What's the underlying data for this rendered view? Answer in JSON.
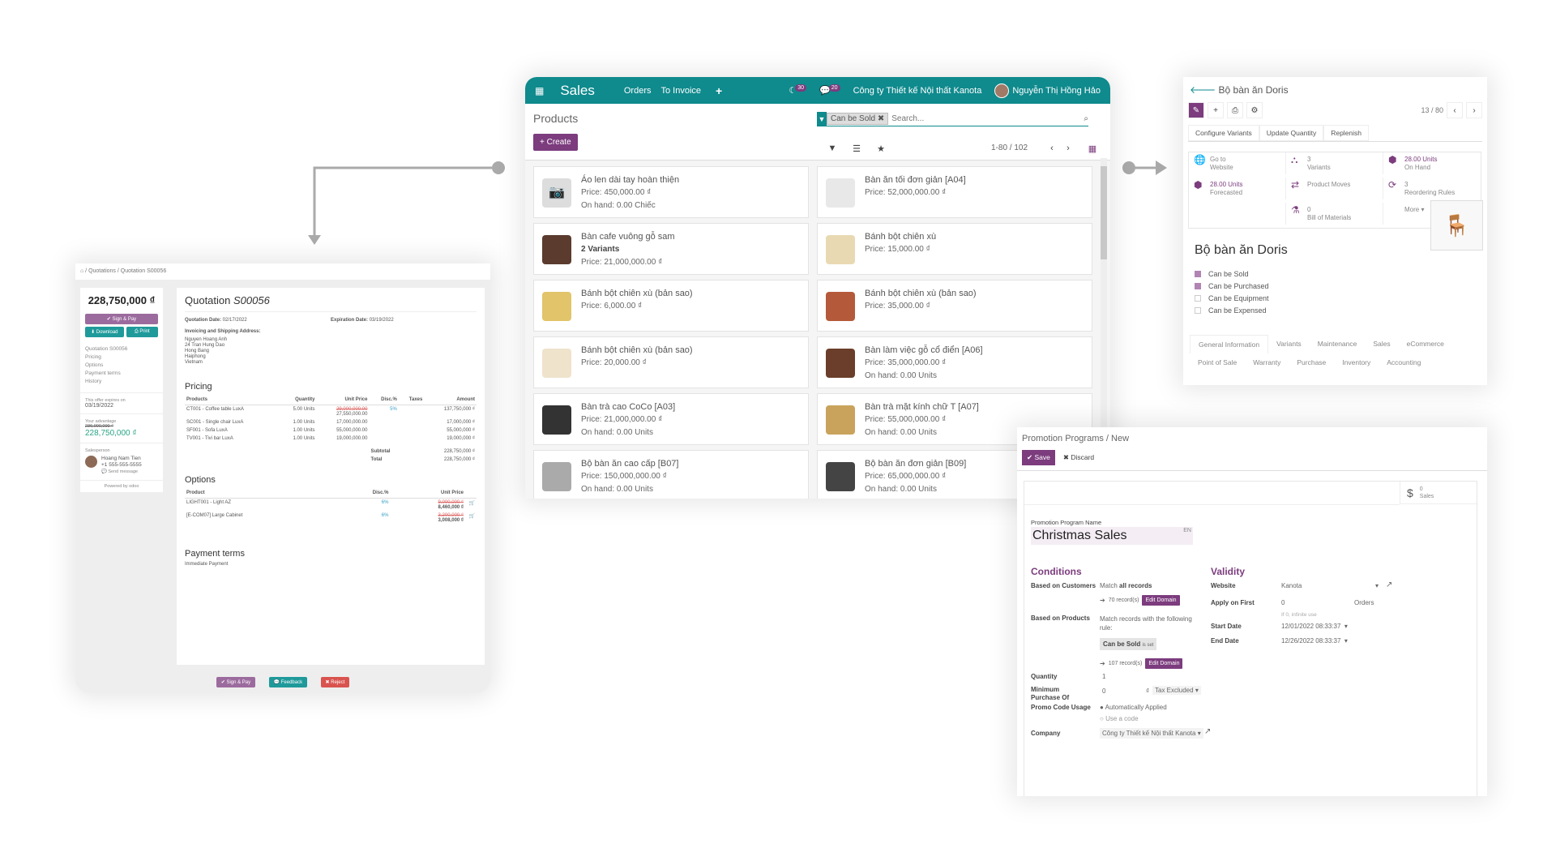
{
  "colors": {
    "teal": "#0f8a8d",
    "purple": "#7c3c7e",
    "red": "#d9534f",
    "green_text": "#28a485"
  },
  "sales_app": {
    "app_name": "Sales",
    "nav": [
      "Orders",
      "To Invoice"
    ],
    "plus_icon": "+",
    "activity_count": "30",
    "message_count": "20",
    "company": "Công ty Thiết kế Nội thất Kanota",
    "user": "Nguyễn Thị Hồng Hảo",
    "page_title": "Products",
    "create_label": "+ Create",
    "facet_label": "Can be Sold",
    "search_placeholder": "Search...",
    "pager": "1-80 / 102",
    "products": [
      {
        "name": "Áo len dài tay hoàn thiện",
        "variants": "",
        "price": "Price: 450,000.00 ₫",
        "onhand": "On hand: 0.00 Chiếc"
      },
      {
        "name": "Bàn ăn tối đơn giản [A04]",
        "variants": "",
        "price": "Price: 52,000,000.00 ₫",
        "onhand": ""
      },
      {
        "name": "Bàn cafe vuông gỗ sam",
        "variants": "2 Variants",
        "price": "Price: 21,000,000.00 ₫",
        "onhand": ""
      },
      {
        "name": "Bánh bột chiên xù",
        "variants": "",
        "price": "Price: 15,000.00 ₫",
        "onhand": ""
      },
      {
        "name": "Bánh bột chiên xù (bản sao)",
        "variants": "",
        "price": "Price: 6,000.00 ₫",
        "onhand": ""
      },
      {
        "name": "Bánh bột chiên xù (bản sao)",
        "variants": "",
        "price": "Price: 35,000.00 ₫",
        "onhand": ""
      },
      {
        "name": "Bánh bột chiên xù (bản sao)",
        "variants": "",
        "price": "Price: 20,000.00 ₫",
        "onhand": ""
      },
      {
        "name": "Bàn làm việc gỗ cổ điển [A06]",
        "variants": "",
        "price": "Price: 35,000,000.00 ₫",
        "onhand": "On hand: 0.00 Units"
      },
      {
        "name": "Bàn trà cao CoCo [A03]",
        "variants": "",
        "price": "Price: 21,000,000.00 ₫",
        "onhand": "On hand: 0.00 Units"
      },
      {
        "name": "Bàn trà mặt kính chữ T [A07]",
        "variants": "",
        "price": "Price: 55,000,000.00 ₫",
        "onhand": "On hand: 0.00 Units"
      },
      {
        "name": "Bộ bàn ăn cao cấp [B07]",
        "variants": "",
        "price": "Price: 150,000,000.00 ₫",
        "onhand": "On hand: 0.00 Units"
      },
      {
        "name": "Bộ bàn ăn đơn giản [B09]",
        "variants": "",
        "price": "Price: 65,000,000.00 ₫",
        "onhand": "On hand: 0.00 Units"
      }
    ]
  },
  "quotation": {
    "breadcrumb": [
      "Quotations",
      "Quotation S00056"
    ],
    "total": "228,750,000 ₫",
    "sign_pay": "✔ Sign & Pay",
    "download": "⬇ Download",
    "print": "⎙ Print",
    "nav": [
      "Quotation S00056",
      "Pricing",
      "Options",
      "Payment terms",
      "History"
    ],
    "expires_label": "This offer expires on",
    "expires_date": "03/19/2022",
    "advantage_label": "Your advantage",
    "advantage_old": "236,000,000 ₫",
    "advantage_new": "228,750,000 ₫",
    "salesperson_label": "Salesperson",
    "salesperson_name": "Hoang Nam Tien",
    "salesperson_phone": "+1 555-555-5555",
    "send_message": "Send message",
    "powered_by": "Powered by odoo",
    "title_prefix": "Quotation",
    "title_number": "S00056",
    "quotation_date_label": "Quotation Date:",
    "quotation_date": "02/17/2022",
    "expiration_date_label": "Expiration Date:",
    "expiration_date": "03/19/2022",
    "address_label": "Invoicing and Shipping Address:",
    "address": [
      "Nguyen Hoang Anh",
      "24 Tran Hung Dao",
      "Hong Bang",
      "Haiphong",
      "Vietnam"
    ],
    "pricing_title": "Pricing",
    "pricing_headers": [
      "Products",
      "Quantity",
      "Unit Price",
      "Disc.%",
      "Taxes",
      "Amount"
    ],
    "pricing_rows": [
      {
        "product": "CT001 - Coffee table LuxA",
        "qty": "5.00 Units",
        "old_price": "29,000,000.00",
        "price": "27,550,000.00",
        "disc": "5%",
        "amount": "137,750,000 ₫"
      },
      {
        "product": "SC001 - Single chair LuxA",
        "qty": "1.00 Units",
        "old_price": "",
        "price": "17,000,000.00",
        "disc": "",
        "amount": "17,000,000 ₫"
      },
      {
        "product": "SF001 - Sofa LuxA",
        "qty": "1.00 Units",
        "old_price": "",
        "price": "55,000,000.00",
        "disc": "",
        "amount": "55,000,000 ₫"
      },
      {
        "product": "TV001 - Tivi bar LuxA",
        "qty": "1.00 Units",
        "old_price": "",
        "price": "19,000,000.00",
        "disc": "",
        "amount": "19,000,000 ₫"
      }
    ],
    "subtotal_label": "Subtotal",
    "subtotal": "228,750,000 ₫",
    "total_label": "Total",
    "total_value": "228,750,000 ₫",
    "options_title": "Options",
    "options_headers": [
      "Product",
      "Disc.%",
      "Unit Price"
    ],
    "options_rows": [
      {
        "product": "LIGHT001 - Light AZ",
        "disc": "6%",
        "old_price": "9,000,000 ₫",
        "price": "8,460,000 ₫"
      },
      {
        "product": "[E-COM07] Large Cabinet",
        "disc": "6%",
        "old_price": "3,200,000 ₫",
        "price": "3,008,000 ₫"
      }
    ],
    "payment_title": "Payment terms",
    "payment_value": "Immediate Payment",
    "footer_sign": "✔ Sign & Pay",
    "footer_feedback": "Feedback",
    "footer_reject": "✖ Reject"
  },
  "product_form": {
    "breadcrumb": "Bộ bàn ăn Doris",
    "pager": "13 / 80",
    "actions": [
      "Configure Variants",
      "Update Quantity",
      "Replenish"
    ],
    "stats": [
      {
        "icon": "globe-icon",
        "value": "Go to",
        "label": "Website",
        "highlight": false
      },
      {
        "icon": "sitemap-icon",
        "value": "3",
        "label": "Variants",
        "highlight": false
      },
      {
        "icon": "cubes-icon",
        "value": "28.00 Units",
        "label": "On Hand",
        "highlight": true
      },
      {
        "icon": "cubes-icon",
        "value": "28.00 Units",
        "label": "Forecasted",
        "highlight": true
      },
      {
        "icon": "exchange-icon",
        "value": "",
        "label": "Product Moves",
        "highlight": false
      },
      {
        "icon": "refresh-icon",
        "value": "3",
        "label": "Reordering Rules",
        "highlight": false
      },
      {
        "icon": "",
        "value": "",
        "label": "",
        "highlight": false
      },
      {
        "icon": "flask-icon",
        "value": "0",
        "label": "Bill of Materials",
        "highlight": false
      },
      {
        "icon": "",
        "value": "",
        "label": "More ▾",
        "highlight": false
      }
    ],
    "name": "Bộ bàn ăn Doris",
    "checks": [
      {
        "label": "Can be Sold",
        "checked": true
      },
      {
        "label": "Can be Purchased",
        "checked": true
      },
      {
        "label": "Can be Equipment",
        "checked": false
      },
      {
        "label": "Can be Expensed",
        "checked": false
      }
    ],
    "tabs": [
      "General Information",
      "Variants",
      "Maintenance",
      "Sales",
      "eCommerce",
      "Point of Sale",
      "Warranty",
      "Purchase",
      "Inventory",
      "Accounting"
    ]
  },
  "promotion": {
    "breadcrumb": [
      "Promotion Programs",
      "New"
    ],
    "save": "✔ Save",
    "discard": "✖ Discard",
    "sales_count": "0",
    "sales_label": "Sales",
    "name_label": "Promotion Program Name",
    "name_value": "Christmas Sales",
    "lang": "EN",
    "conditions_title": "Conditions",
    "based_customers_label": "Based on Customers",
    "based_customers_value_pre": "Match",
    "based_customers_value_bold": "all records",
    "customers_records": "70 record(s)",
    "edit_domain": "Edit Domain",
    "based_products_label": "Based on Products",
    "based_products_value": "Match records with the following rule:",
    "rule_field": "Can be Sold",
    "rule_op": "is set",
    "products_records": "107 record(s)",
    "quantity_label": "Quantity",
    "quantity_value": "1",
    "min_purchase_label": "Minimum Purchase Of",
    "min_purchase_value": "0",
    "currency": "₫",
    "tax_mode": "Tax Excluded",
    "promo_usage_label": "Promo Code Usage",
    "promo_options": [
      {
        "label": "Automatically Applied",
        "selected": true
      },
      {
        "label": "Use a code",
        "selected": false
      }
    ],
    "company_label": "Company",
    "company_value": "Công ty Thiết kế Nội thất Kanota",
    "validity_title": "Validity",
    "website_label": "Website",
    "website_value": "Kanota",
    "apply_first_label": "Apply on First",
    "apply_first_value": "0",
    "apply_first_unit": "Orders",
    "apply_first_hint": "If 0, infinite use",
    "start_date_label": "Start Date",
    "start_date": "12/01/2022 08:33:37",
    "end_date_label": "End Date",
    "end_date": "12/26/2022 08:33:37"
  }
}
